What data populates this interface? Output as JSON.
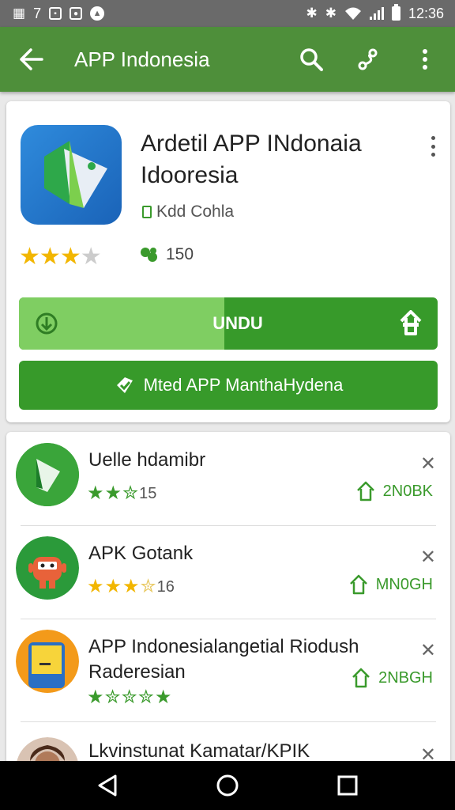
{
  "status_bar": {
    "left_icons": [
      "calendar-icon",
      "seven",
      "photo-icon",
      "app-icon",
      "nav-icon"
    ],
    "seven": "7",
    "time": "12:36"
  },
  "app_bar": {
    "title": "APP Indonesia"
  },
  "app_detail": {
    "name": "Ardetil APP INdonaia Idooresia",
    "developer": "Kdd Cohla",
    "rating_stars": 3.5,
    "downloads": "150",
    "download_button": {
      "label": "UNDU",
      "progress": 0.49
    },
    "open_button": {
      "label": "Mted APP ManthaHydena"
    }
  },
  "related": [
    {
      "name": "Uelle hdamibr",
      "rating_stars": 3,
      "rating_count": "15",
      "action_label": "2N0BK"
    },
    {
      "name": "APK Gotank",
      "rating_stars": 3.5,
      "rating_count": "16",
      "action_label": "MN0GH"
    },
    {
      "name": "APP Indonesialangetial Riodush Raderesian",
      "rating_stars": 5,
      "rating_count": "",
      "action_label": "2NBGH"
    },
    {
      "name": "Lkvinstunat Kamatar/KPIK",
      "rating_stars": 0,
      "rating_count": "",
      "action_label": ""
    }
  ],
  "colors": {
    "app_bar": "#4e8f3a",
    "button_green": "#379a2a",
    "progress_green": "#7fce62",
    "star_gold": "#f2b600"
  }
}
